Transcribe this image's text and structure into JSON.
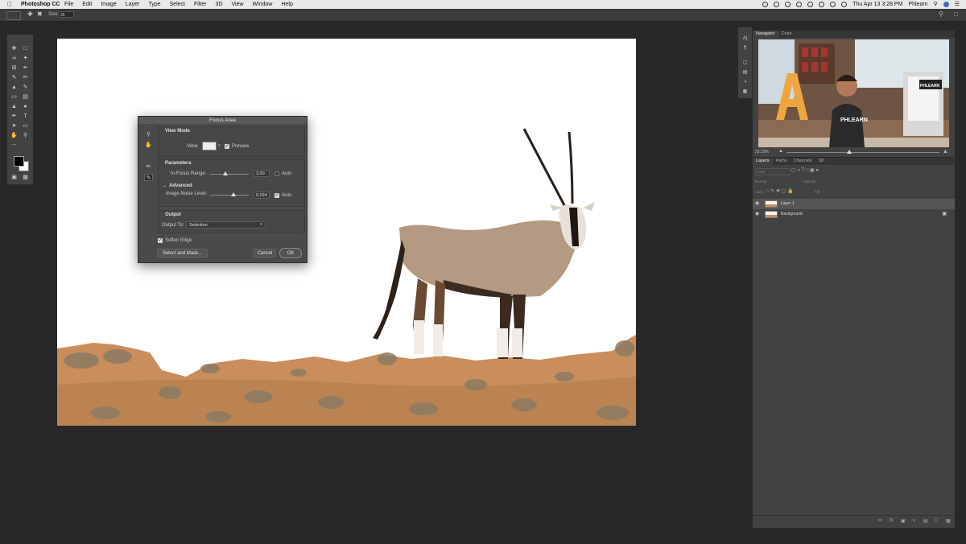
{
  "menubar": {
    "app_name": "Photoshop CC",
    "items": [
      "File",
      "Edit",
      "Image",
      "Layer",
      "Type",
      "Select",
      "Filter",
      "3D",
      "View",
      "Window",
      "Help"
    ],
    "clock": "Thu Apr 13  3:28 PM",
    "user": "Phlearn"
  },
  "options_bar": {
    "size_label": "Size:",
    "size_value": "35"
  },
  "dialog": {
    "title": "Focus Area",
    "view_mode": {
      "header": "View Mode",
      "view_label": "View:",
      "preview_label": "Preview",
      "preview_checked": true
    },
    "parameters": {
      "header": "Parameters",
      "in_focus_label": "In-Focus Range:",
      "in_focus_value": "3.00",
      "in_focus_auto_label": "Auto",
      "in_focus_auto_checked": false,
      "advanced_label": "Advanced",
      "noise_label": "Image Noise Level:",
      "noise_value": "0.024",
      "noise_auto_label": "Auto",
      "noise_auto_checked": true
    },
    "output": {
      "header": "Output",
      "output_to_label": "Output To:",
      "output_to_value": "Selection"
    },
    "soften_edge_label": "Soften Edge",
    "soften_edge_checked": true,
    "buttons": {
      "select_and_mask": "Select and Mask...",
      "cancel": "Cancel",
      "ok": "OK"
    }
  },
  "navigator": {
    "tabs": [
      "Navigator",
      "Color"
    ],
    "zoom": "33.33%",
    "video_text": "PHLEARN"
  },
  "layers_panel": {
    "tabs": [
      "Layers",
      "Paths",
      "Channels",
      "3D"
    ],
    "kind_label": "Kind",
    "blend_mode": "Normal",
    "opacity_label": "Opacity:",
    "lock_label": "Lock:",
    "fill_label": "Fill:",
    "layers": [
      {
        "name": "Layer 1",
        "selected": true,
        "locked": false
      },
      {
        "name": "Background",
        "selected": false,
        "locked": true
      }
    ]
  },
  "colors": {
    "app_bg": "#282828",
    "panel_bg": "#424242",
    "menubar_bg": "#e9e9e9",
    "sand": "#c98e5c"
  }
}
